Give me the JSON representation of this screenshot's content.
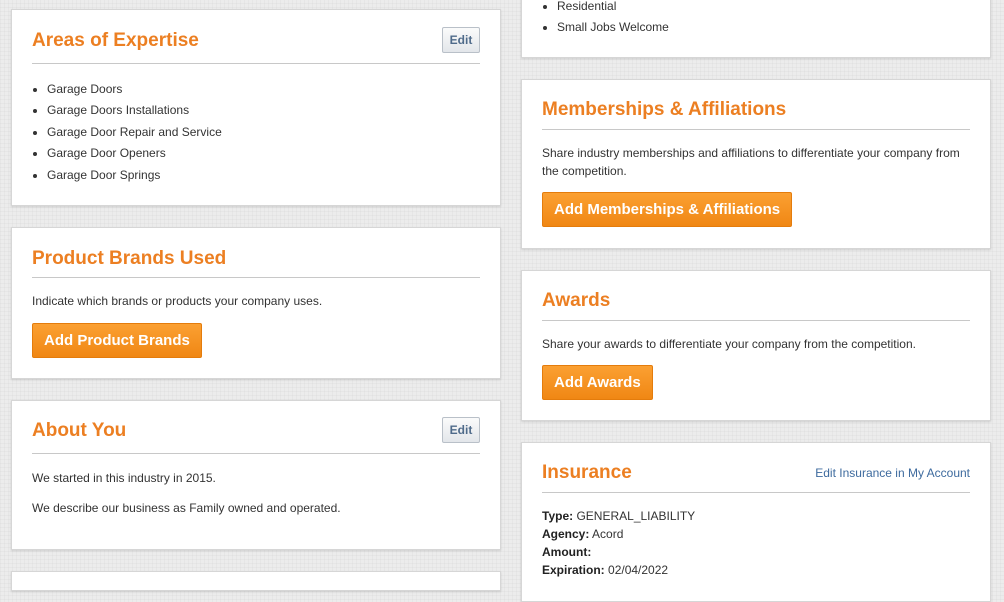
{
  "left": {
    "expertise": {
      "title": "Areas of Expertise",
      "edit_label": "Edit",
      "items": [
        "Garage Doors",
        "Garage Doors Installations",
        "Garage Door Repair and Service",
        "Garage Door Openers",
        "Garage Door Springs"
      ]
    },
    "brands": {
      "title": "Product Brands Used",
      "description": "Indicate which brands or products your company uses.",
      "button_label": "Add Product Brands"
    },
    "about": {
      "title": "About You",
      "edit_label": "Edit",
      "line1": "We started in this industry in 2015.",
      "line2": "We describe our business as Family owned and operated."
    }
  },
  "right": {
    "top": {
      "items": [
        "Residential",
        "Small Jobs Welcome"
      ]
    },
    "memberships": {
      "title": "Memberships & Affiliations",
      "description": "Share industry memberships and affiliations to differentiate your company from the competition.",
      "button_label": "Add Memberships & Affiliations"
    },
    "awards": {
      "title": "Awards",
      "description": "Share your awards to differentiate your company from the competition.",
      "button_label": "Add Awards"
    },
    "insurance": {
      "title": "Insurance",
      "link_label": "Edit Insurance in My Account",
      "type_label": "Type:",
      "type_value": "GENERAL_LIABILITY",
      "agency_label": "Agency:",
      "agency_value": "Acord",
      "amount_label": "Amount:",
      "amount_value": "",
      "expiration_label": "Expiration:",
      "expiration_value": "02/04/2022"
    }
  },
  "colors": {
    "accent": "#ec7f22",
    "link": "#3d6a9e",
    "edit_text": "#4f6b8a"
  }
}
